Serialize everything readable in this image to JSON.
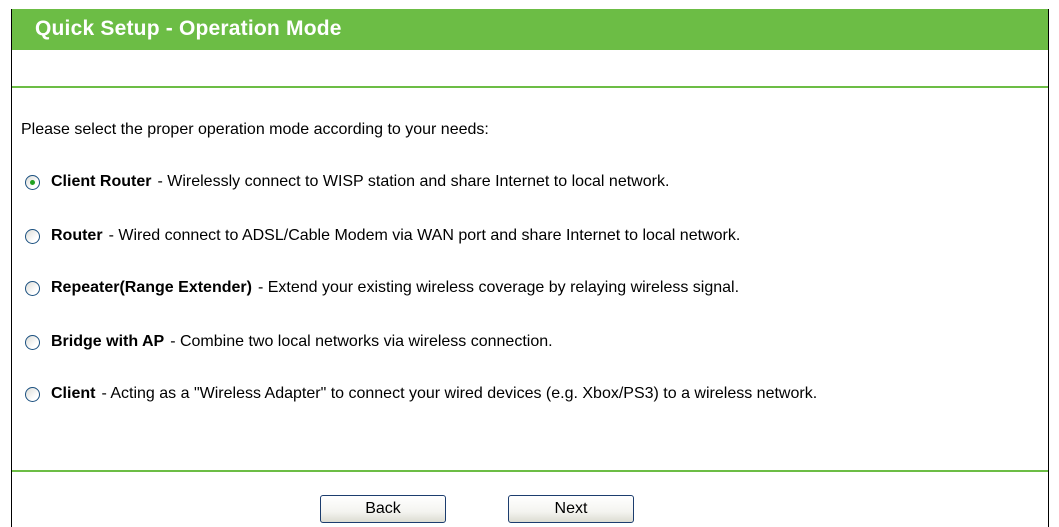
{
  "header": {
    "title": "Quick Setup - Operation Mode"
  },
  "intro_text": "Please select the proper operation mode according to your needs:",
  "options": [
    {
      "name": "Client Router",
      "description": "- Wirelessly connect to WISP station and share Internet to local network.",
      "selected": true
    },
    {
      "name": "Router",
      "description": "- Wired connect to ADSL/Cable Modem via WAN port and share Internet to local network.",
      "selected": false
    },
    {
      "name": "Repeater(Range Extender)",
      "description": "- Extend your existing wireless coverage by relaying wireless signal.",
      "selected": false
    },
    {
      "name": "Bridge with AP",
      "description": "- Combine two local networks via wireless connection.",
      "selected": false
    },
    {
      "name": "Client",
      "description": "- Acting as a \"Wireless Adapter\" to connect your wired devices (e.g. Xbox/PS3) to a wireless network.",
      "selected": false
    }
  ],
  "buttons": {
    "back_label": "Back",
    "next_label": "Next"
  },
  "colors": {
    "accent": "#6cbd45",
    "radio_dot": "#21a121",
    "border": "#1c3d6e"
  }
}
